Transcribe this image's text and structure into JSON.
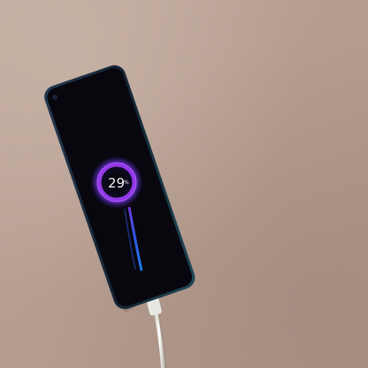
{
  "scene": {
    "description_kind": "photo",
    "surface_color": "#b69e91"
  },
  "phone": {
    "body_color": "#0f1626",
    "edge_color": "#1d3a4e",
    "screen_color": "#06060d"
  },
  "charging_indicator": {
    "battery_level": 0.29,
    "label": "29",
    "unit": "%",
    "ring_color": "#b04df5",
    "glow_color": "#7a3dff",
    "stem_color": "#2d6cff"
  },
  "cable": {
    "color": "#f2f1ec"
  }
}
